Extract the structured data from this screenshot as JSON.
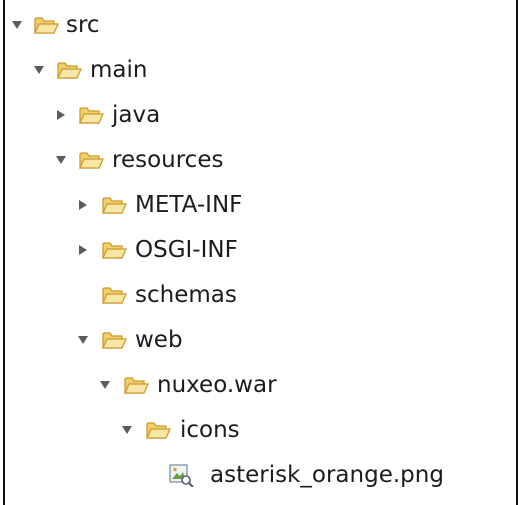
{
  "tree": {
    "items": [
      {
        "label": "src",
        "state": "expanded",
        "icon": "folder-open-icon"
      },
      {
        "label": "main",
        "state": "expanded",
        "icon": "folder-open-icon"
      },
      {
        "label": "java",
        "state": "collapsed",
        "icon": "folder-open-icon"
      },
      {
        "label": "resources",
        "state": "expanded",
        "icon": "folder-open-icon"
      },
      {
        "label": "META-INF",
        "state": "collapsed",
        "icon": "folder-open-icon"
      },
      {
        "label": "OSGI-INF",
        "state": "collapsed",
        "icon": "folder-open-icon"
      },
      {
        "label": "schemas",
        "state": "leaf",
        "icon": "folder-open-icon"
      },
      {
        "label": "web",
        "state": "expanded",
        "icon": "folder-open-icon"
      },
      {
        "label": "nuxeo.war",
        "state": "expanded",
        "icon": "folder-open-icon"
      },
      {
        "label": "icons",
        "state": "expanded",
        "icon": "folder-open-icon"
      },
      {
        "label": "asterisk_orange.png",
        "state": "leaf",
        "icon": "image-file-icon"
      }
    ]
  },
  "colors": {
    "folder_fill": "#f7e6a6",
    "folder_stroke": "#cf9a2c",
    "twisty": "#5c5c5c",
    "text": "#1c1c1c",
    "border": "#111111"
  }
}
